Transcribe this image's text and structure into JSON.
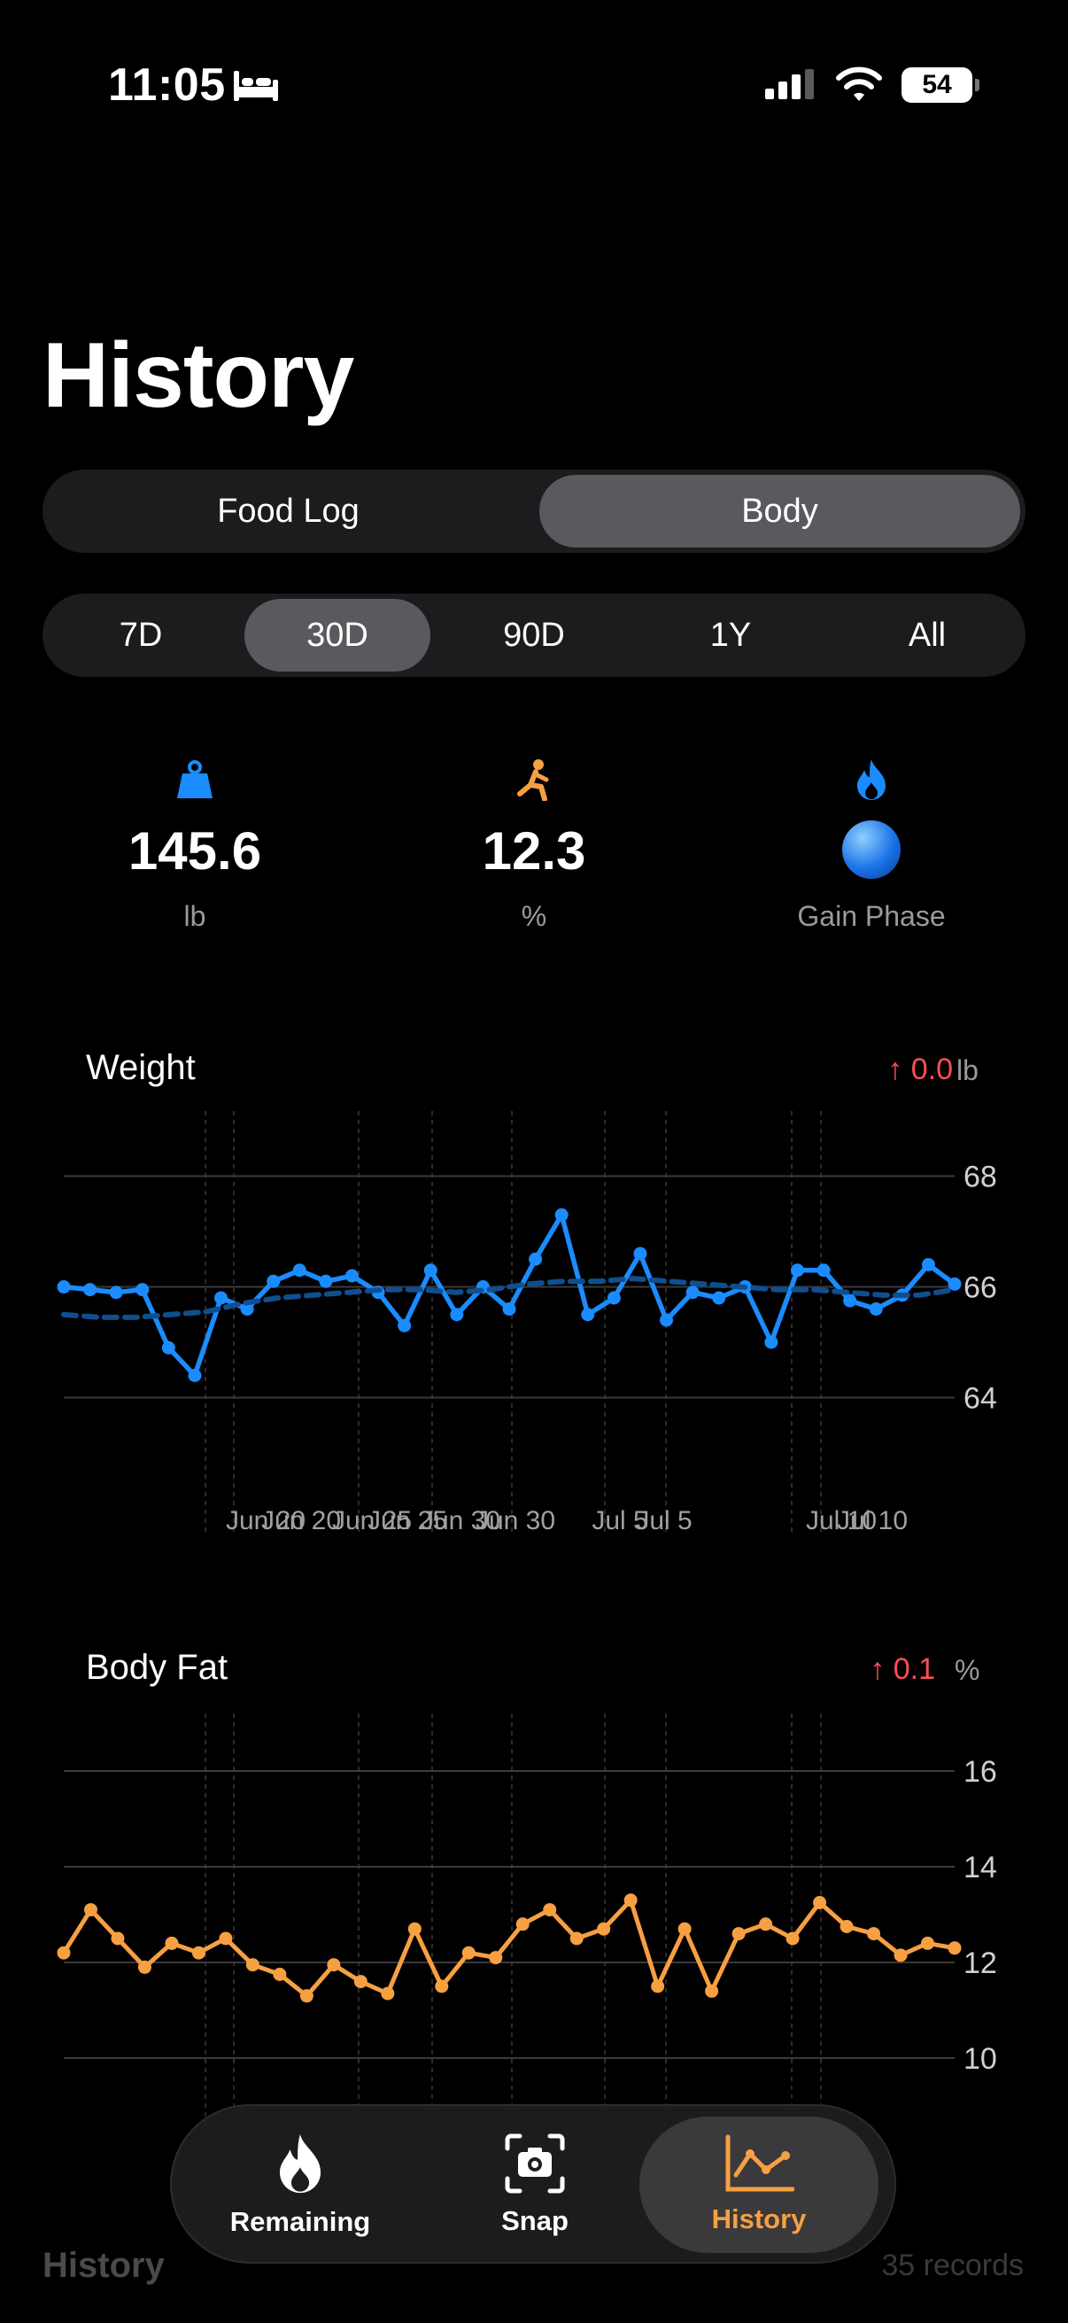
{
  "status": {
    "time": "11:05",
    "battery": "54"
  },
  "page": {
    "title": "History"
  },
  "main_tabs": [
    {
      "label": "Food Log",
      "active": false
    },
    {
      "label": "Body",
      "active": true
    }
  ],
  "ranges": [
    {
      "label": "7D",
      "active": false
    },
    {
      "label": "30D",
      "active": true
    },
    {
      "label": "90D",
      "active": false
    },
    {
      "label": "1Y",
      "active": false
    },
    {
      "label": "All",
      "active": false
    }
  ],
  "stats": {
    "weight": {
      "value": "145.6",
      "unit": "lb",
      "icon": "weight-icon"
    },
    "body_fat": {
      "value": "12.3",
      "unit": "%",
      "icon": "exercise-icon"
    },
    "phase": {
      "label": "Gain Phase",
      "icon": "flame-icon",
      "emoji": "🔵"
    }
  },
  "weight_chart": {
    "title": "Weight",
    "delta": "↑ 0.0",
    "unit": "lb"
  },
  "bodyfat_chart": {
    "title": "Body Fat",
    "delta": "↑ 0.1",
    "unit": "%"
  },
  "colors": {
    "accent_blue": "#1a8cff",
    "accent_orange": "#f7a042",
    "delta_red": "#ff4d55"
  },
  "footer": {
    "title": "History",
    "count": "35 records"
  },
  "tabbar": [
    {
      "label": "Remaining",
      "icon": "flame-icon"
    },
    {
      "label": "Snap",
      "icon": "camera-icon"
    },
    {
      "label": "History",
      "icon": "chart-icon",
      "active": true
    }
  ],
  "chart_data": [
    {
      "type": "line",
      "title": "Weight",
      "ylabel": "lb",
      "ylim": [
        63,
        69
      ],
      "yticks": [
        64,
        66,
        68
      ],
      "xtick_labels": [
        "Jun 20",
        "Jun 20",
        "Jun 25",
        "Jun 25",
        "Jun 30",
        "Jun 30",
        "Jul 5",
        "Jul 5",
        "Jul 10",
        "Jul 10"
      ],
      "series": [
        {
          "values": [
            66.0,
            65.95,
            65.9,
            65.95,
            64.9,
            64.4,
            65.8,
            65.6,
            66.1,
            66.3,
            66.1,
            66.2,
            65.9,
            65.3,
            66.3,
            65.5,
            66.0,
            65.6,
            66.5,
            67.3,
            65.5,
            65.8,
            66.6,
            65.4,
            65.9,
            65.8,
            66.0,
            65.0,
            66.3,
            66.3,
            65.75,
            65.6,
            65.85,
            66.4,
            66.05
          ]
        },
        {
          "values": [
            65.5,
            65.45,
            65.45,
            65.5,
            65.55,
            65.7,
            65.8,
            65.85,
            65.9,
            65.95,
            65.95,
            65.9,
            65.95,
            66.05,
            66.1,
            66.1,
            66.15,
            66.1,
            66.05,
            66.0,
            65.95,
            65.95,
            65.9,
            65.85,
            65.85,
            65.95
          ]
        }
      ]
    },
    {
      "type": "line",
      "title": "Body Fat",
      "ylabel": "%",
      "ylim": [
        9,
        17
      ],
      "yticks": [
        10,
        12,
        14,
        16
      ],
      "series": [
        {
          "values": [
            12.2,
            13.1,
            12.5,
            11.9,
            12.4,
            12.2,
            12.5,
            11.95,
            11.75,
            11.3,
            11.95,
            11.6,
            11.35,
            12.7,
            11.5,
            12.2,
            12.1,
            12.8,
            13.1,
            12.5,
            12.7,
            13.3,
            11.5,
            12.7,
            11.4,
            12.6,
            12.8,
            12.5,
            13.25,
            12.75,
            12.6,
            12.15,
            12.4,
            12.3
          ]
        }
      ]
    }
  ]
}
